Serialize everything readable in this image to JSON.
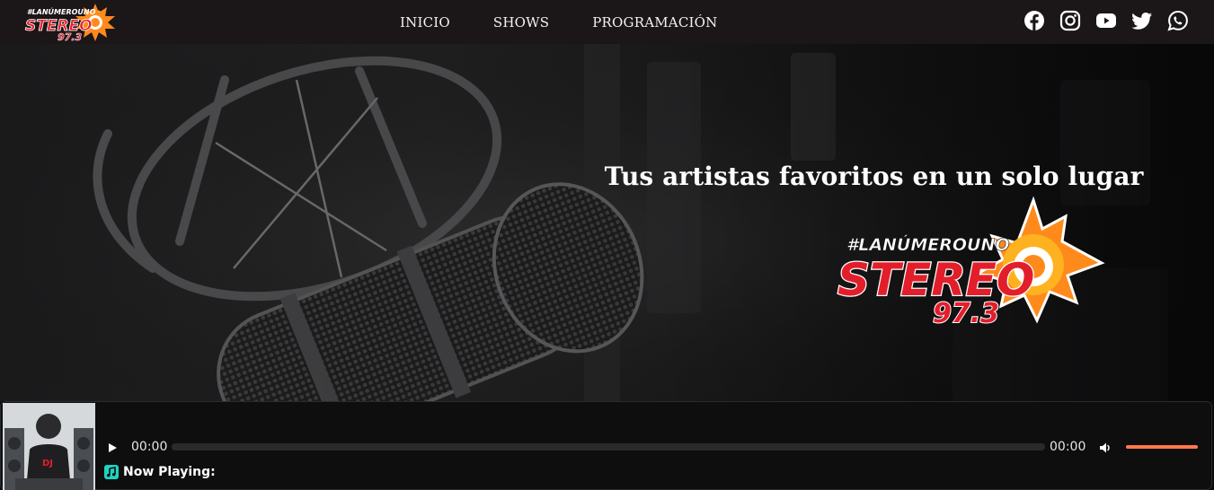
{
  "brand": {
    "hashtag": "#LANÚMEROUNO",
    "name": "STEREO",
    "frequency": "97.3",
    "colors": {
      "primary": "#e31e2b",
      "accent": "#ff8a1c",
      "sun": "#ffb21f"
    }
  },
  "nav": {
    "items": [
      {
        "label": "INICIO"
      },
      {
        "label": "SHOWS"
      },
      {
        "label": "PROGRAMACIÓN"
      }
    ]
  },
  "socials": [
    {
      "icon": "facebook-icon"
    },
    {
      "icon": "instagram-icon"
    },
    {
      "icon": "youtube-icon"
    },
    {
      "icon": "twitter-icon"
    },
    {
      "icon": "whatsapp-icon"
    }
  ],
  "hero": {
    "headline": "Tus artistas favoritos en un solo lugar",
    "background": "microphone-photo"
  },
  "player": {
    "current_time": "00:00",
    "duration": "00:00",
    "progress": 0,
    "volume": 1.0,
    "now_playing_label": "Now Playing:",
    "cover_text": "DJ",
    "colors": {
      "accent": "#ff6a3a"
    }
  }
}
